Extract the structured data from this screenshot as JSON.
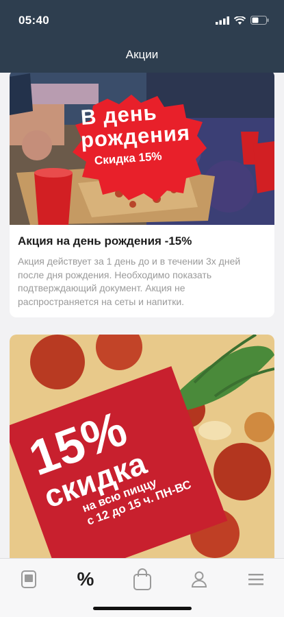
{
  "status_bar": {
    "time": "05:40",
    "icons": [
      "signal-icon",
      "wifi-icon",
      "battery-icon"
    ]
  },
  "header": {
    "title": "Акции"
  },
  "promos": [
    {
      "image_text_line1": "В день",
      "image_text_line2": "рождения",
      "image_subtext": "Скидка 15%",
      "title": "Акция на день рождения -15%",
      "description": "Акция действует за 1 день до и в течении 3х дней после дня рождения. Необходимо показать подтверждающий документ. Акция не распространяется на сеты и напитки."
    },
    {
      "image_text_percent": "15%",
      "image_text_word": "скидка",
      "image_text_line1": "на всю пиццу",
      "image_text_line2": "с 12 до 15 ч. ПН-ВС"
    }
  ],
  "tabbar": {
    "items": [
      {
        "icon": "menu-card-icon"
      },
      {
        "icon": "percent-icon",
        "label": "%",
        "active": true
      },
      {
        "icon": "shopping-bag-icon"
      },
      {
        "icon": "profile-icon"
      },
      {
        "icon": "hamburger-menu-icon"
      }
    ]
  },
  "colors": {
    "header_bg": "#2e3e4f",
    "promo_red": "#c8202e",
    "badge_red": "#e8202a",
    "tab_icon": "#9a9a9a"
  }
}
